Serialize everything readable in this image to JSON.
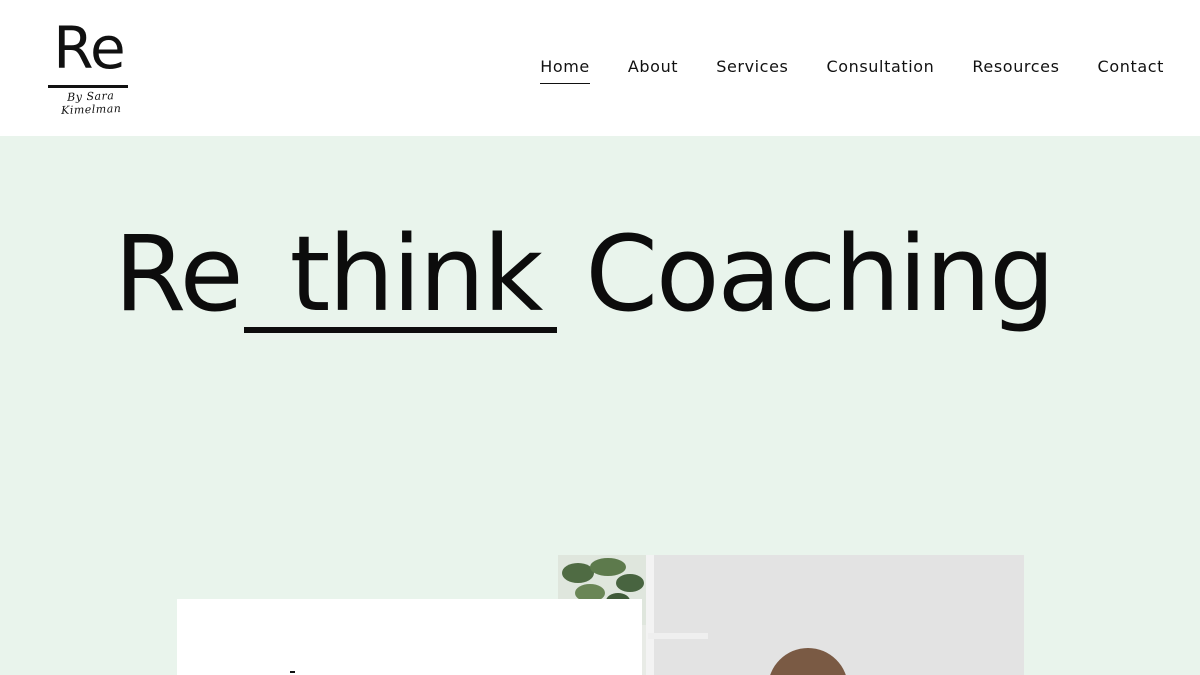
{
  "header": {
    "logo": {
      "mark": "Re",
      "tagline": "By Sara Kimelman"
    },
    "nav": {
      "items": [
        {
          "label": "Home",
          "active": true
        },
        {
          "label": "About",
          "active": false
        },
        {
          "label": "Services",
          "active": false
        },
        {
          "label": "Consultation",
          "active": false
        },
        {
          "label": "Resources",
          "active": false
        },
        {
          "label": "Contact",
          "active": false
        }
      ]
    }
  },
  "hero": {
    "title_part1": "Re",
    "title_part2": "think",
    "title_part3": "Coaching",
    "background_color": "#e9f4ec"
  },
  "colors": {
    "text": "#111111",
    "header_bg": "#ffffff",
    "hero_bg": "#e9f4ec"
  }
}
